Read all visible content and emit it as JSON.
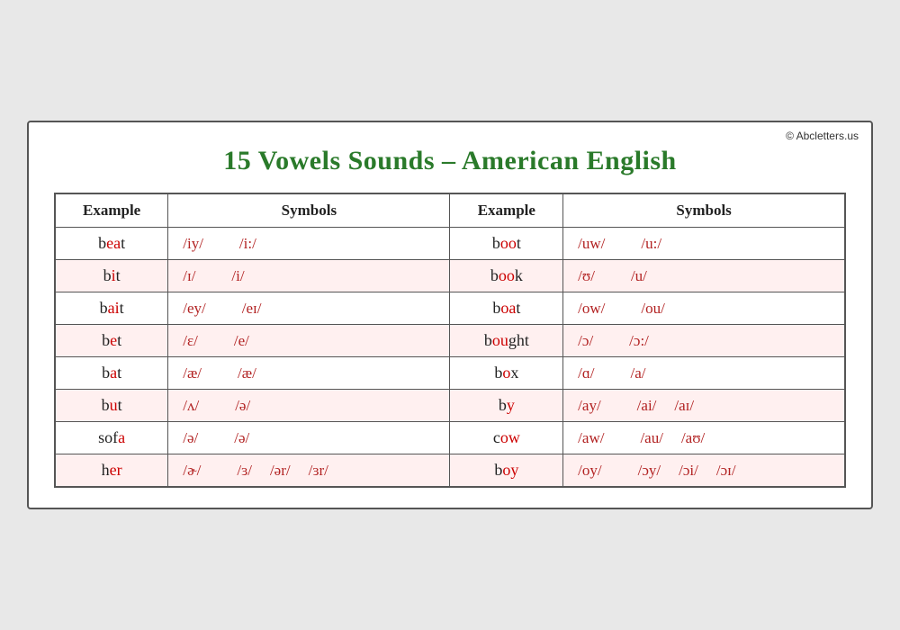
{
  "copyright": "© Abcletters.us",
  "title": "15 Vowels Sounds – American English",
  "headers": {
    "example": "Example",
    "symbols": "Symbols"
  },
  "rows": [
    {
      "ex1_pre": "b",
      "ex1_vow": "ea",
      "ex1_post": "t",
      "sym1": "/iy/",
      "sym1b": "/i:/",
      "ex2_pre": "b",
      "ex2_vow": "oo",
      "ex2_post": "t",
      "sym2": "/uw/",
      "sym2b": "/u:/"
    },
    {
      "ex1_pre": "b",
      "ex1_vow": "i",
      "ex1_post": "t",
      "sym1": "/ɪ/",
      "sym1b": "/i/",
      "ex2_pre": "b",
      "ex2_vow": "oo",
      "ex2_post": "k",
      "sym2": "/ʊ/",
      "sym2b": "/u/"
    },
    {
      "ex1_pre": "b",
      "ex1_vow": "ai",
      "ex1_post": "t",
      "sym1": "/ey/",
      "sym1b": "/eɪ/",
      "ex2_pre": "b",
      "ex2_vow": "oa",
      "ex2_post": "t",
      "sym2": "/ow/",
      "sym2b": "/ou/"
    },
    {
      "ex1_pre": "b",
      "ex1_vow": "e",
      "ex1_post": "t",
      "sym1": "/ɛ/",
      "sym1b": "/e/",
      "ex2_pre": "b",
      "ex2_vow": "ou",
      "ex2_post": "ght",
      "sym2": "/ɔ/",
      "sym2b": "/ɔ:/"
    },
    {
      "ex1_pre": "b",
      "ex1_vow": "a",
      "ex1_post": "t",
      "sym1": "/æ/",
      "sym1b": "/æ/",
      "ex2_pre": "b",
      "ex2_vow": "o",
      "ex2_post": "x",
      "sym2": "/ɑ/",
      "sym2b": "/a/"
    },
    {
      "ex1_pre": "b",
      "ex1_vow": "u",
      "ex1_post": "t",
      "sym1": "/ʌ/",
      "sym1b": "/ə/",
      "ex2_pre": "b",
      "ex2_vow": "y",
      "ex2_post": "",
      "sym2": "/ay/",
      "sym2b": "/ai/",
      "sym2c": "/aɪ/"
    },
    {
      "ex1_pre": "sof",
      "ex1_vow": "a",
      "ex1_post": "",
      "sym1": "/ə/",
      "sym1b": "/ə/",
      "ex2_pre": "c",
      "ex2_vow": "ow",
      "ex2_post": "",
      "sym2": "/aw/",
      "sym2b": "/au/",
      "sym2c": "/aʊ/"
    },
    {
      "ex1_pre": "h",
      "ex1_vow": "er",
      "ex1_post": "",
      "sym1": "/ɚ/",
      "sym1b": "/ɜ/",
      "sym1c": "/ər/",
      "sym1d": "/ɜr/",
      "ex2_pre": "b",
      "ex2_vow": "oy",
      "ex2_post": "",
      "sym2": "/oy/",
      "sym2b": "/ɔy/",
      "sym2c": "/ɔi/",
      "sym2d": "/ɔɪ/"
    }
  ]
}
